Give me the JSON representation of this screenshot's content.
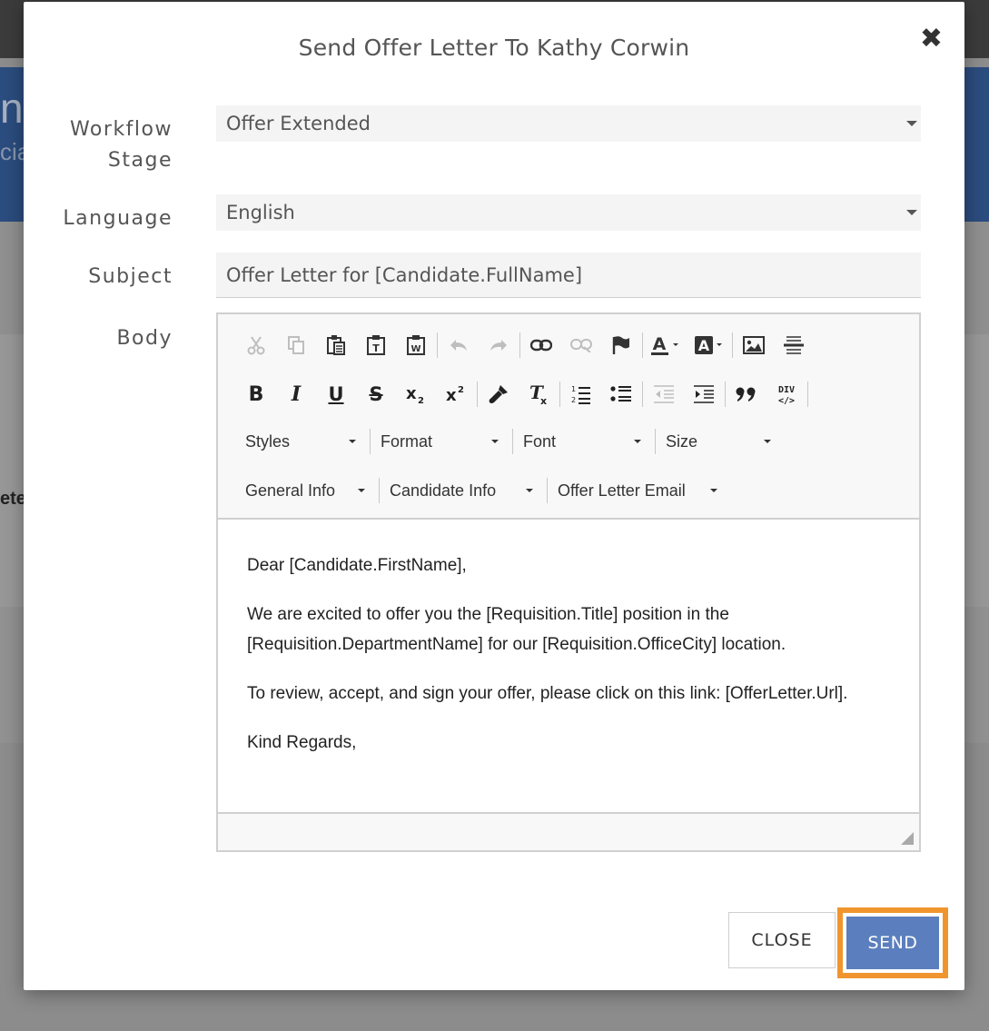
{
  "background": {
    "header_fragment": "n",
    "subheader_fragment": "cia",
    "side_fragment": "ete"
  },
  "modal": {
    "title": "Send Offer Letter To Kathy Corwin",
    "close_icon": "✖"
  },
  "form": {
    "workflow_stage": {
      "label_line1": "Workflow",
      "label_line2": "Stage",
      "value": "Offer Extended"
    },
    "language": {
      "label": "Language",
      "value": "English"
    },
    "subject": {
      "label": "Subject",
      "value": "Offer Letter for [Candidate.FullName]"
    },
    "body": {
      "label": "Body"
    }
  },
  "editor": {
    "toolbar_row1_icons": [
      "cut-icon",
      "copy-icon",
      "paste-icon",
      "paste-text-icon",
      "paste-word-icon",
      "undo-icon",
      "redo-icon",
      "link-icon",
      "unlink-icon",
      "anchor-icon",
      "text-color-icon",
      "background-color-icon",
      "image-icon",
      "horizontal-line-icon"
    ],
    "toolbar_row2_icons": [
      "bold-icon",
      "italic-icon",
      "underline-icon",
      "strikethrough-icon",
      "subscript-icon",
      "superscript-icon",
      "copy-format-icon",
      "remove-format-icon",
      "numbered-list-icon",
      "bulleted-list-icon",
      "decrease-indent-icon",
      "increase-indent-icon",
      "blockquote-icon",
      "div-container-icon"
    ],
    "combos_row3": [
      "Styles",
      "Format",
      "Font",
      "Size"
    ],
    "combos_row4": [
      "General Info",
      "Candidate Info",
      "Offer Letter Email"
    ],
    "paragraphs": [
      "Dear [Candidate.FirstName],",
      "We are excited to offer you the [Requisition.Title] position in the [Requisition.DepartmentName] for our [Requisition.OfficeCity] location.",
      "To review, accept, and sign your offer, please click on this link: [OfferLetter.Url].",
      "Kind Regards,"
    ]
  },
  "buttons": {
    "close": "CLOSE",
    "send": "SEND"
  },
  "colors": {
    "send_button": "#5b7fbe",
    "send_highlight": "#f0952e"
  }
}
